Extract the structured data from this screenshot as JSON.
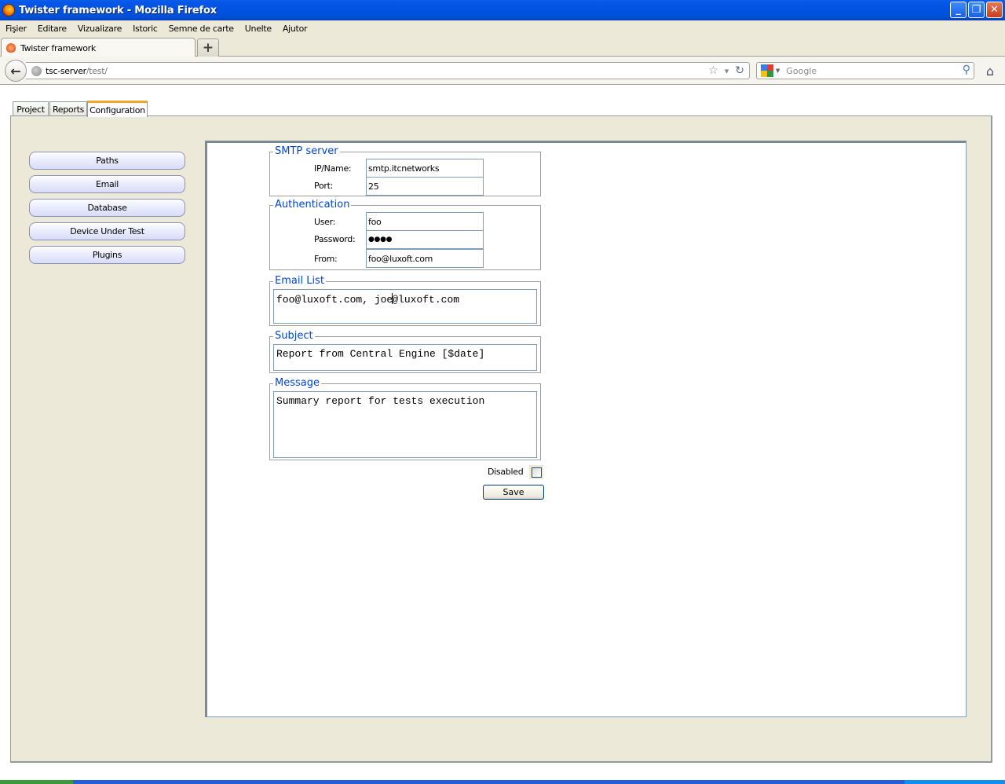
{
  "window": {
    "title": "Twister framework - Mozilla Firefox",
    "controls": {
      "minimize": "_",
      "restore": "❐",
      "close": "✕"
    }
  },
  "menubar": {
    "items": [
      {
        "label": "Fişier",
        "accel": "F"
      },
      {
        "label": "Editare",
        "accel": "E"
      },
      {
        "label": "Vizualizare",
        "accel": "V"
      },
      {
        "label": "Istoric",
        "accel": "I"
      },
      {
        "label": "Semne de carte",
        "accel": "S"
      },
      {
        "label": "Unelte",
        "accel": "U"
      },
      {
        "label": "Ajutor",
        "accel": "j"
      }
    ]
  },
  "browser": {
    "tab_title": "Twister framework",
    "new_tab": "+",
    "url_host": "tsc-server",
    "url_path": "/test/",
    "search_placeholder": "Google",
    "icons": {
      "back": "←",
      "bookmark": "☆",
      "dropdown": "▾",
      "reload": "↻",
      "search": "⚲",
      "home": "⌂"
    }
  },
  "app": {
    "tabs": [
      {
        "label": "Project",
        "active": false
      },
      {
        "label": "Reports",
        "active": false
      },
      {
        "label": "Configuration",
        "active": true
      }
    ],
    "sidebar": {
      "items": [
        {
          "label": "Paths"
        },
        {
          "label": "Email"
        },
        {
          "label": "Database"
        },
        {
          "label": "Device Under Test"
        },
        {
          "label": "Plugins"
        }
      ]
    },
    "email_config": {
      "smtp": {
        "legend": "SMTP server",
        "ip_label": "IP/Name:",
        "ip_value": "smtp.itcnetworks",
        "port_label": "Port:",
        "port_value": "25"
      },
      "auth": {
        "legend": "Authentication",
        "user_label": "User:",
        "user_value": "foo",
        "password_label": "Password:",
        "password_value": "●●●●",
        "from_label": "From:",
        "from_value": "foo@luxoft.com"
      },
      "email_list": {
        "legend": "Email List",
        "value_before_caret": "foo@luxoft.com, joe",
        "value_after_caret": "@luxoft.com"
      },
      "subject": {
        "legend": "Subject",
        "value": "Report from Central Engine [$date]"
      },
      "message": {
        "legend": "Message",
        "value": "Summary report for tests execution"
      },
      "disabled_label": "Disabled",
      "disabled_checked": false,
      "save_label": "Save"
    }
  },
  "colors": {
    "titlebar": "#0053e0",
    "legend_text": "#0046d5",
    "panel_bg": "#ece9d8",
    "active_tab_accent": "#f5a623"
  }
}
